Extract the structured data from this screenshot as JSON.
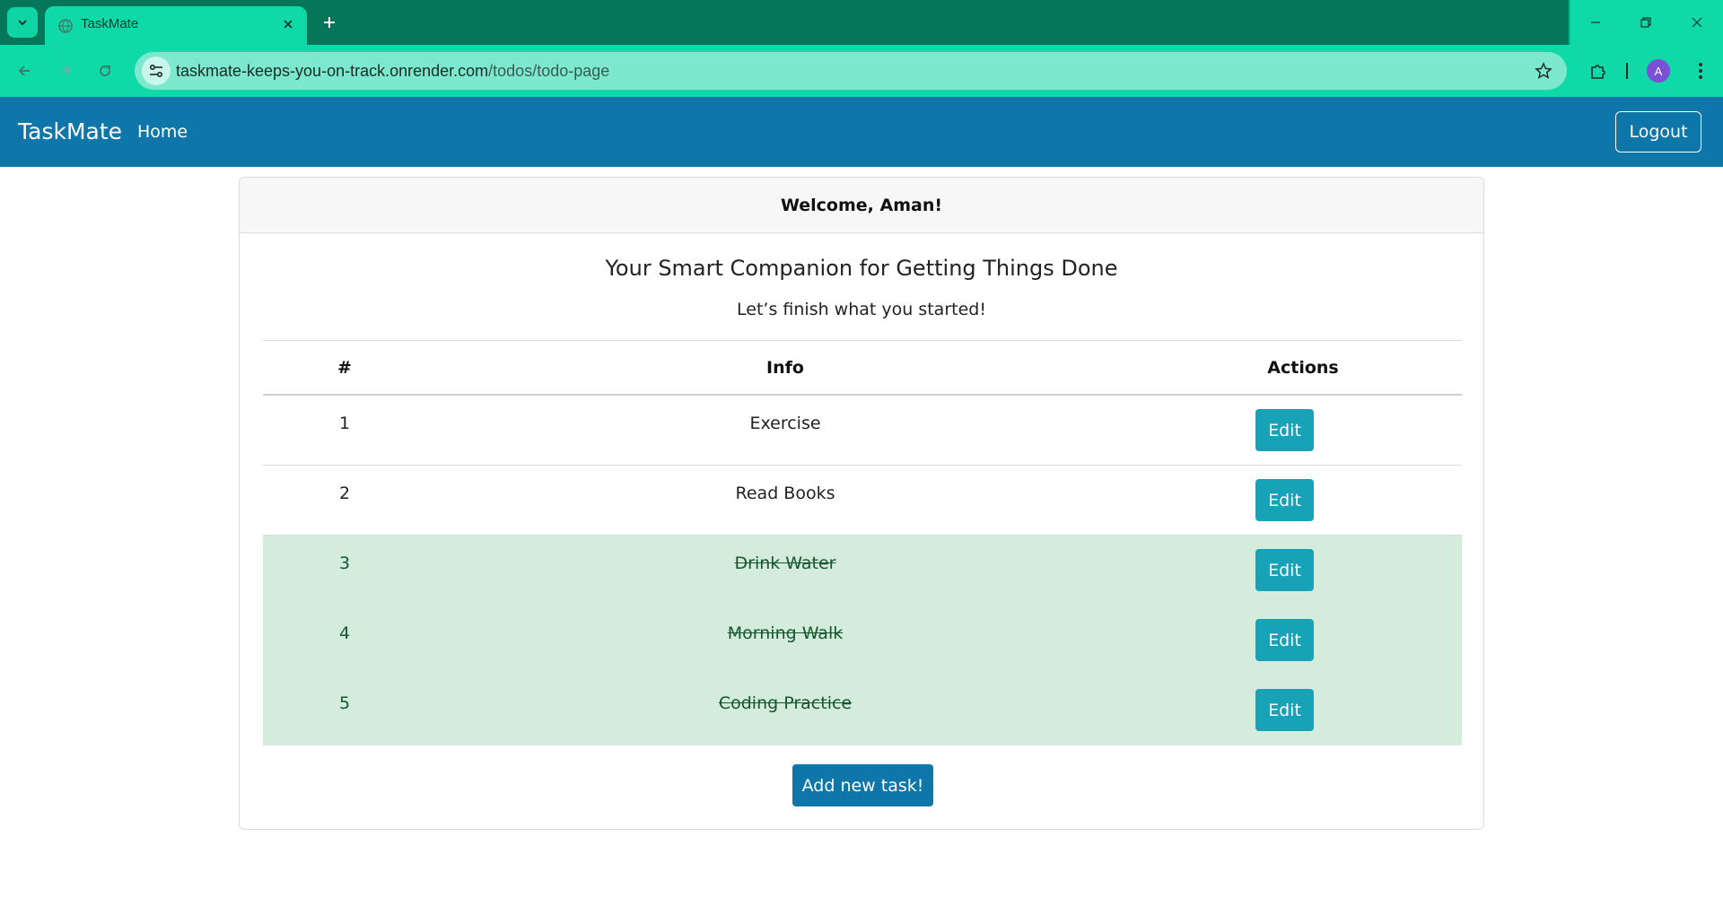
{
  "browser": {
    "tab_title": "TaskMate",
    "url_host": "taskmate-keeps-you-on-track.onrender.com",
    "url_path": "/todos/todo-page",
    "profile_initial": "A",
    "colors": {
      "tabbar": "#05765a",
      "toolbar": "#10d9a8",
      "omnibox": "#7ce9cf"
    }
  },
  "navbar": {
    "brand": "TaskMate",
    "home_label": "Home",
    "logout_label": "Logout",
    "color": "#0f76aa"
  },
  "card": {
    "header": "Welcome, Aman!",
    "title": "Your Smart Companion for Getting Things Done",
    "subtitle": "Let’s finish what you started!"
  },
  "table": {
    "columns": [
      "#",
      "Info",
      "Actions"
    ],
    "rows": [
      {
        "num": "1",
        "info": "Exercise",
        "action": "Edit",
        "completed": false
      },
      {
        "num": "2",
        "info": "Read Books",
        "action": "Edit",
        "completed": false
      },
      {
        "num": "3",
        "info": "Drink Water",
        "action": "Edit",
        "completed": true
      },
      {
        "num": "4",
        "info": "Morning Walk",
        "action": "Edit",
        "completed": true
      },
      {
        "num": "5",
        "info": "Coding Practice",
        "action": "Edit",
        "completed": true
      }
    ]
  },
  "add_task_label": "Add new task!",
  "colors": {
    "edit_button": "#17a2b8",
    "completed_row": "#d4ecdb",
    "completed_text": "#15572e"
  }
}
